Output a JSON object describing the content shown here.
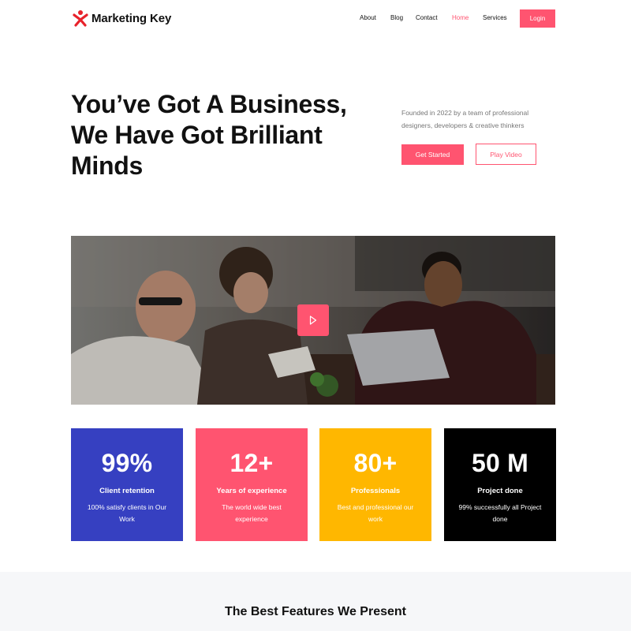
{
  "brand": {
    "name": "Marketing Key",
    "accent": "#ff5470",
    "logo_icon": "person-icon"
  },
  "nav": {
    "items": [
      {
        "label": "About",
        "active": false
      },
      {
        "label": "Blog",
        "active": false
      },
      {
        "label": "Contact",
        "active": false
      },
      {
        "label": "Home",
        "active": true
      },
      {
        "label": "Services",
        "active": false
      }
    ],
    "login_label": "Login"
  },
  "hero": {
    "title": "You’ve Got A Business, We Have Got Brilliant Minds",
    "subtitle": "Founded in 2022 by a team of professional designers, developers & creative thinkers",
    "primary_label": "Get Started",
    "secondary_label": "Play Video"
  },
  "video": {
    "play_icon": "play-icon"
  },
  "stats": [
    {
      "value": "99%",
      "label": "Client retention",
      "desc": "100% satisfy clients in Our Work",
      "color": "#3640c1"
    },
    {
      "value": "12+",
      "label": "Years of experience",
      "desc": "The world wide best experience",
      "color": "#ff5470"
    },
    {
      "value": "80+",
      "label": "Professionals",
      "desc": "Best and professional our work",
      "color": "#ffb700"
    },
    {
      "value": "50 M",
      "label": "Project done",
      "desc": "99% successfully all Project done",
      "color": "#000000"
    }
  ],
  "features": {
    "title": "The Best Features We Present",
    "background": "#f6f7f9"
  }
}
